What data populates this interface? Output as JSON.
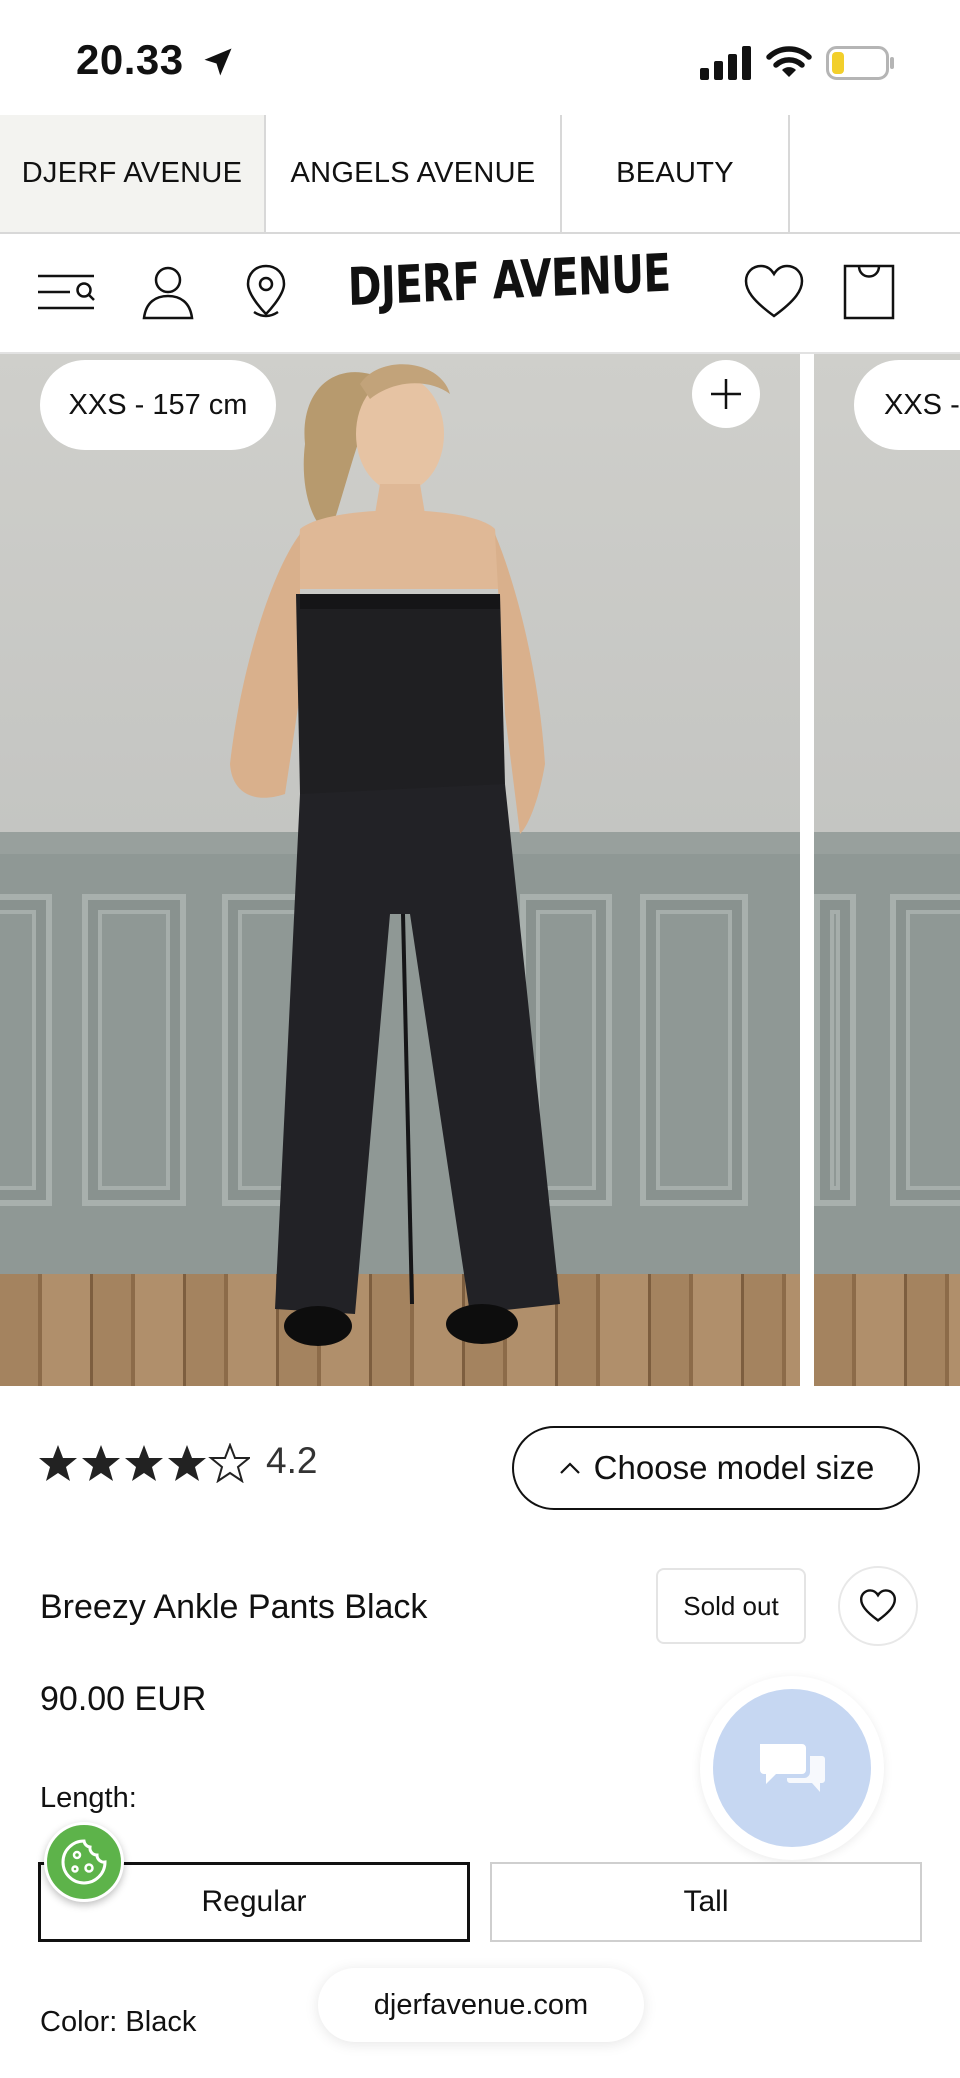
{
  "status_bar": {
    "time": "20.33",
    "icons": [
      "location-arrow-icon",
      "cellular-signal-icon",
      "wifi-icon",
      "battery-low-icon"
    ]
  },
  "brand_tabs": [
    {
      "label": "DJERF AVENUE",
      "active": true
    },
    {
      "label": "ANGELS AVENUE",
      "active": false
    },
    {
      "label": "BEAUTY",
      "active": false
    }
  ],
  "header": {
    "logo": "DJERF AVENUE",
    "icons": [
      "menu-search-icon",
      "account-icon",
      "store-locator-icon",
      "wishlist-icon",
      "cart-icon"
    ]
  },
  "gallery": {
    "slides": [
      {
        "model_size": "XXS - 157 cm"
      },
      {
        "model_size": "XXS -"
      }
    ],
    "zoom_icon": "plus-icon"
  },
  "rating": {
    "value": "4.2",
    "stars": 4.2,
    "max": 5
  },
  "choose_model_size": {
    "label": "Choose model size",
    "icon": "chevron-up-icon"
  },
  "product": {
    "title": "Breezy Ankle Pants Black",
    "badge": "Sold out",
    "price": "90.00 EUR"
  },
  "length": {
    "label": "Length:",
    "options": [
      {
        "label": "Regular",
        "selected": true
      },
      {
        "label": "Tall",
        "selected": false
      }
    ]
  },
  "color": {
    "label": "Color: Black"
  },
  "browser": {
    "url": "djerfavenue.com"
  },
  "colors": {
    "chat_bubble": "#c6d7f2",
    "cookie_button": "#5db34a",
    "active_tab_bg": "#f3f3f0"
  }
}
